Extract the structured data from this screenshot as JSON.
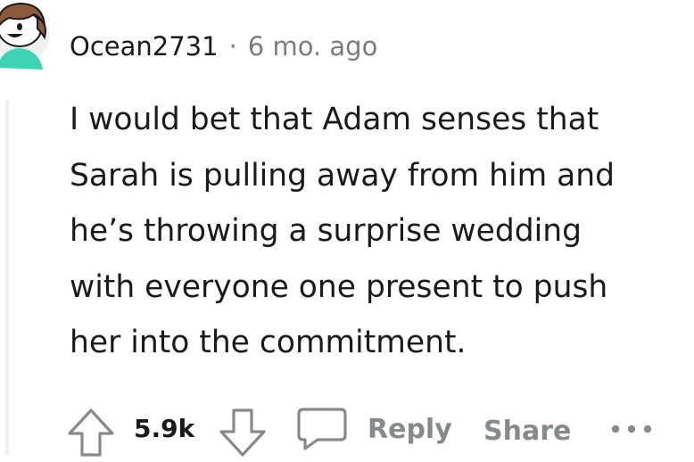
{
  "comment": {
    "author": "Ocean2731",
    "separator": "·",
    "timestamp": "6 mo. ago",
    "body_lines": [
      "I would bet that Adam senses that",
      "Sarah is pulling away from him and",
      "he’s throwing a surprise wedding",
      "with everyone one present to push",
      "her into the commitment."
    ]
  },
  "actions": {
    "score": "5.9k",
    "reply_label": "Reply",
    "share_label": "Share"
  },
  "icons": {
    "avatar": "snoo-avatar-icon",
    "upvote": "upvote-arrow-icon",
    "downvote": "downvote-arrow-icon",
    "reply": "comment-bubble-icon",
    "more": "more-dots-icon"
  },
  "colors": {
    "text": "#1a1a1b",
    "meta": "#7c7c7c",
    "action_gray": "#878a8c",
    "thread_line": "#edeff1",
    "avatar_shirt": "#3fd3b5",
    "avatar_hair": "#8b5a3c"
  }
}
